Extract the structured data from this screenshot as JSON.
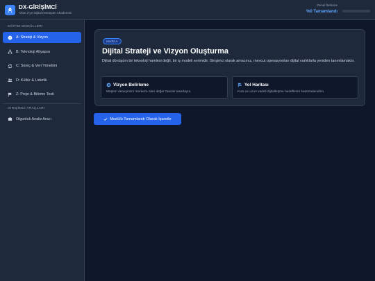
{
  "header": {
    "title": "DX-GİRİŞİMCİ",
    "subtitle": "Atlan Z'ye Dijital Dönüşüm Akademisi",
    "progress_label": "Genel İlerleme",
    "progress_value": "%0 Tamamlandı",
    "progress_fraction": 0
  },
  "sidebar": {
    "section1_title": "EĞİTİM MODÜLLERİ",
    "modules": [
      {
        "label": "A: Strateji & Vizyon",
        "icon": "compass-icon",
        "active": true
      },
      {
        "label": "B: Teknoloji Altyapısı",
        "icon": "network-icon",
        "active": false
      },
      {
        "label": "C: Süreç & Veri Yönetimi",
        "icon": "cycle-icon",
        "active": false
      },
      {
        "label": "D: Kültür & Liderlik",
        "icon": "users-icon",
        "active": false
      },
      {
        "label": "Z: Proje & Bitirme Testi",
        "icon": "flag-icon",
        "active": false
      }
    ],
    "section2_title": "GİRİŞİMCİ ARAÇLARI",
    "tools": [
      {
        "label": "Olgunluk Analiz Aracı",
        "icon": "briefcase-icon"
      }
    ]
  },
  "main": {
    "badge": "Modül A",
    "title": "Dijital Strateji ve Vizyon Oluşturma",
    "description": "Dijital dönüşüm bir teknoloji hamlesi değil, bir iş modeli evrimidir. Girişimci olarak amacınız, mevcut operasyonları dijital varlıklarla yeniden tanımlamaktır.",
    "cards": [
      {
        "title": "Vizyon Belirleme",
        "desc": "Müşteri deneyimini merkeze alan değer önerisi tasarlayın.",
        "icon": "eye-icon"
      },
      {
        "title": "Yol Haritası",
        "desc": "Kısa ve uzun vadeli dijitalleşme hedeflerini kademelendirin.",
        "icon": "roadmap-icon"
      }
    ],
    "complete_button": "Modülü Tamamlandı Olarak İşaretle"
  },
  "colors": {
    "accent": "#2563eb",
    "background": "#0f172a",
    "panel": "#1e293b"
  }
}
